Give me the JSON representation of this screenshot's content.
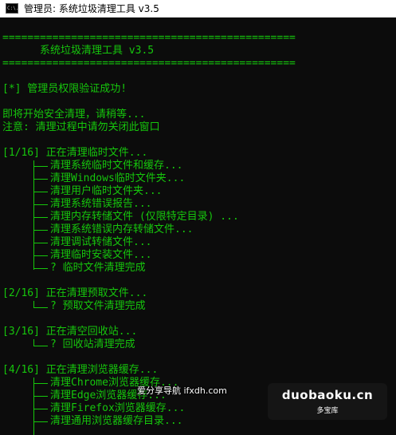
{
  "window": {
    "icon_text": "C:\\.",
    "title": "管理员: 系统垃圾清理工具 v3.5"
  },
  "console": {
    "rule": "===============================================",
    "header_title": "      系统垃圾清理工具 v3.5",
    "auth_ok": "[*] 管理员权限验证成功!",
    "starting": "即将开始安全清理，请稍等...",
    "notice": "注意: 清理过程中请勿关闭此窗口",
    "sections": [
      {
        "title": "[1/16] 正在清理临时文件...",
        "items": [
          "清理系统临时文件和缓存...",
          "清理Windows临时文件夹...",
          "清理用户临时文件夹...",
          "清理系统错误报告...",
          "清理内存转储文件 (仅限特定目录) ...",
          "清理系统错误内存转储文件...",
          "清理调试转储文件...",
          "清理临时安装文件...",
          "? 临时文件清理完成"
        ]
      },
      {
        "title": "[2/16] 正在清理预取文件...",
        "items": [
          "? 预取文件清理完成"
        ]
      },
      {
        "title": "[3/16] 正在清空回收站...",
        "items": [
          "? 回收站清理完成"
        ]
      },
      {
        "title": "[4/16] 正在清理浏览器缓存...",
        "items": [
          "清理Chrome浏览器缓存...",
          "清理Edge浏览器缓存...",
          "清理Firefox浏览器缓存...",
          "清理通用浏览器缓存目录..."
        ]
      }
    ]
  },
  "watermark": {
    "site_text": "爱分享导航 ifxdh.com",
    "logo_main": "duobaoku.cn",
    "logo_sub": "多宝库"
  }
}
